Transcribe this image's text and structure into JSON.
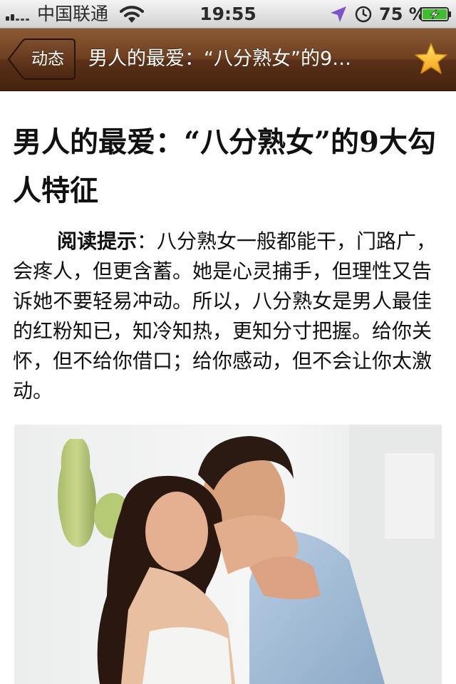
{
  "status_bar": {
    "carrier": "中国联通",
    "time": "19:55",
    "battery_percent": "75 %",
    "battery_level": 0.75,
    "signal_icon": "signal-bars-icon",
    "wifi_icon": "wifi-icon",
    "location_icon": "location-arrow-icon",
    "alarm_icon": "alarm-clock-icon",
    "battery_icon": "battery-charging-icon"
  },
  "nav_bar": {
    "back_label": "动态",
    "title": "男人的最爱：“八分熟女”的9…",
    "favorite_icon": "star-icon",
    "color": "#5a3018"
  },
  "article": {
    "headline": "男人的最爱：“八分熟女”的9大勾人特征",
    "intro_label": "阅读提示",
    "intro_text": "：八分熟女一般都能干，门路广，会疼人，但更含蓄。她是心灵捕手，但理性又告诉她不要轻易冲动。所以，八分熟女是男人最佳的红粉知已，知冷知热，更知分寸把握。给你关怀，但不给你借口；给你感动，但不会让你太激动。"
  }
}
